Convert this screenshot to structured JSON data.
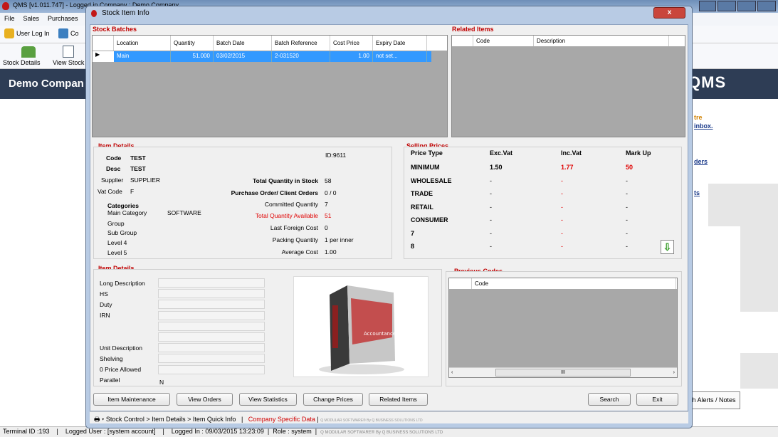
{
  "app": {
    "title": "QMS  [v1.011.747]  -  Logged in Company : Demo Company",
    "menu": [
      "File",
      "Sales",
      "Purchases"
    ],
    "user_login": "User Log In",
    "stock_details": "Stock Details",
    "view_stock": "View Stock",
    "company": "Demo Compan",
    "logo": "QMS",
    "right_links": [
      "tre",
      "inbox.",
      "ders",
      "ts"
    ],
    "alerts": "h Alerts / Notes",
    "status": {
      "terminal": "Terminal ID :193",
      "user": "Logged User : [system account]",
      "logged_in": "Logged In : 09/03/2015 13:23:09",
      "role": "Role : system",
      "footer": "Q MODULAR SOFTWARE® By Q BUSINESS SOLUTIONS LTD"
    }
  },
  "dialog": {
    "title": "Stock Item Info",
    "close": "x"
  },
  "batches": {
    "title": "Stock Batches",
    "headers": [
      "Location",
      "Quantity",
      "Batch Date",
      "Batch Reference",
      "Cost Price",
      "Expiry Date"
    ],
    "rows": [
      [
        "Main",
        "51.000",
        "03/02/2015",
        "2-031520",
        "1.00",
        "not set..."
      ]
    ]
  },
  "related": {
    "title": "Related Items",
    "headers": [
      "Code",
      "Description"
    ]
  },
  "item": {
    "title": "Item Details",
    "code_label": "Code",
    "code": "TEST",
    "desc_label": "Desc",
    "desc": "TEST",
    "supplier_label": "Supplier",
    "supplier": "SUPPLIER",
    "vat_label": "Vat Code",
    "vat": "F",
    "id": "ID:9611",
    "cat_label": "Categories",
    "main_cat_label": "Main Category",
    "main_cat": "SOFTWARE",
    "group_label": "Group",
    "subgroup_label": "Sub Group",
    "level4_label": "Level 4",
    "level5_label": "Level 5",
    "total_stock_label": "Total Quantity in Stock",
    "total_stock": "58",
    "po_label": "Purchase Order/ Client Orders",
    "po": "0 / 0",
    "committed_label": "Committed Quantity",
    "committed": "7",
    "available_label": "Total Quantity Available",
    "available": "51",
    "foreign_label": "Last Foreign Cost",
    "foreign": "0",
    "packing_label": "Packing Quantity",
    "packing": "1 per inner",
    "avg_label": "Average Cost",
    "avg": "1.00"
  },
  "prices": {
    "title": "Selling Prices",
    "headers": [
      "Price Type",
      "Exc.Vat",
      "Inc.Vat",
      "Mark Up"
    ],
    "rows": [
      [
        "MINIMUM",
        "1.50",
        "1.77",
        "50"
      ],
      [
        "WHOLESALE",
        "-",
        "-",
        "-"
      ],
      [
        "TRADE",
        "-",
        "-",
        "-"
      ],
      [
        "RETAIL",
        "-",
        "-",
        "-"
      ],
      [
        "CONSUMER",
        "-",
        "-",
        "-"
      ],
      [
        "7",
        "-",
        "-",
        "-"
      ],
      [
        "8",
        "-",
        "-",
        "-"
      ]
    ]
  },
  "details2": {
    "title": "Item Details",
    "labels": [
      "Long Description",
      "HS",
      "Duty",
      "IRN",
      "",
      "",
      "Unit Description",
      "Shelving",
      "0 Price Allowed",
      "Parallel"
    ],
    "parallel": "N"
  },
  "product_image": {
    "text": "Accountance"
  },
  "prev": {
    "title": "Previous Codes",
    "headers": [
      "Code"
    ],
    "scroll": "III"
  },
  "buttons": {
    "maintenance": "Item Maintenance",
    "orders": "View Orders",
    "stats": "View Statistics",
    "prices": "Change Prices",
    "related": "Related Items",
    "search": "Search",
    "exit": "Exit"
  },
  "crumb": {
    "path": "▾ Stock Control > Item Details > Item Quick Info",
    "sep": "|",
    "company_data": "Company Specific Data",
    "footer": "Q MODULAR SOFTWARE® By Q BUSINESS SOLUTIONS LTD"
  }
}
